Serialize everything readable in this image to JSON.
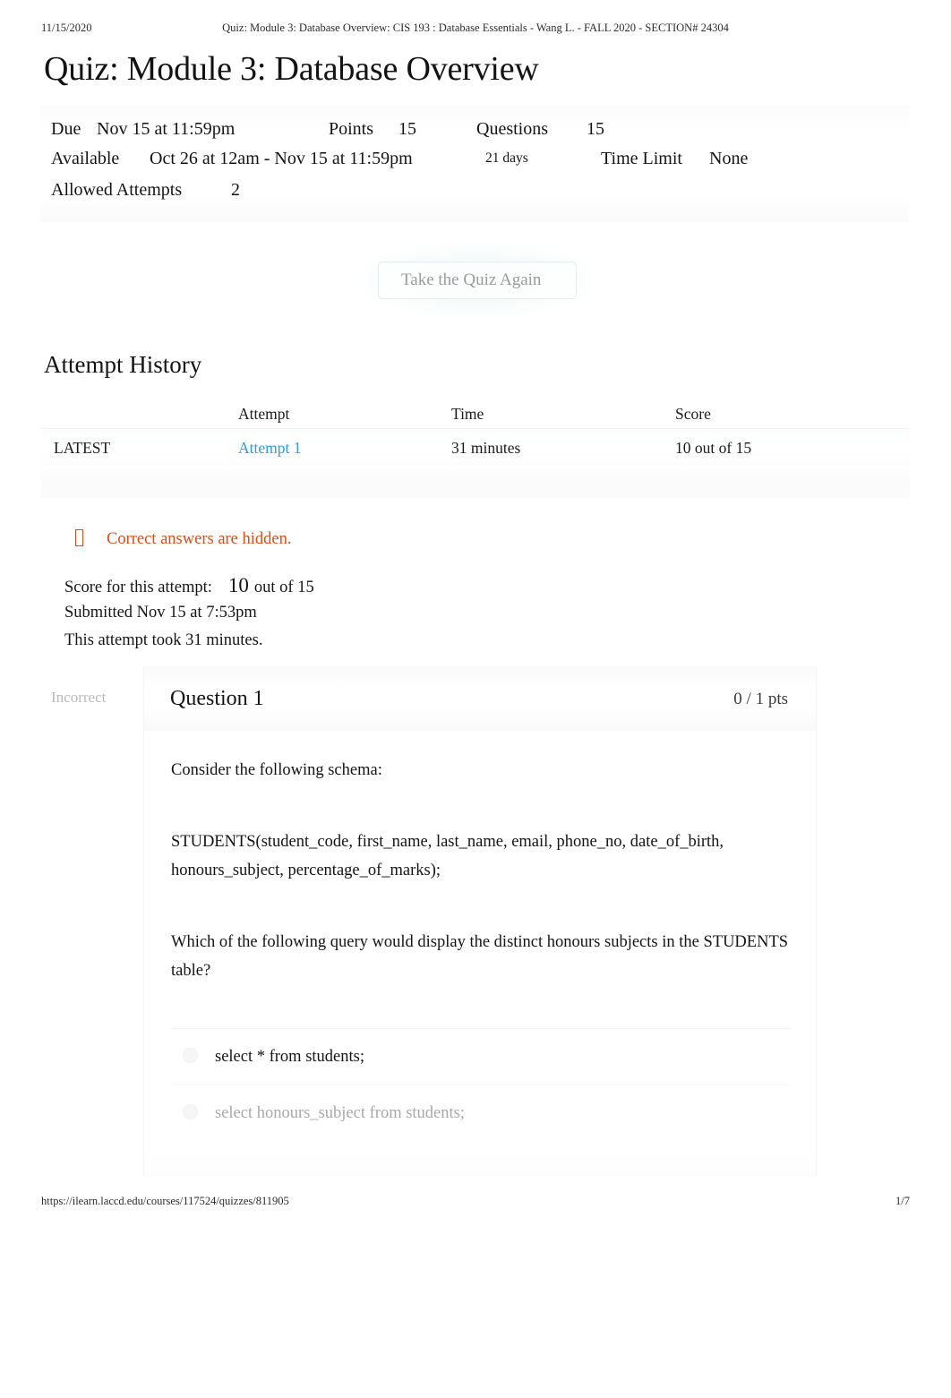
{
  "print_header": {
    "date": "11/15/2020",
    "title": "Quiz: Module 3: Database Overview: CIS 193 : Database Essentials - Wang L. - FALL 2020 - SECTION# 24304"
  },
  "print_footer": {
    "url": "https://ilearn.laccd.edu/courses/117524/quizzes/811905",
    "page": "1/7"
  },
  "page": {
    "title": "Quiz: Module 3: Database Overview"
  },
  "meta": {
    "due_label": "Due",
    "due_value": "Nov 15 at 11:59pm",
    "points_label": "Points",
    "points_value": "15",
    "questions_label": "Questions",
    "questions_value": "15",
    "available_label": "Available",
    "available_value": "Oct 26 at 12am - Nov 15 at 11:59pm",
    "available_duration": "21 days",
    "time_limit_label": "Time Limit",
    "time_limit_value": "None",
    "allowed_attempts_label": "Allowed Attempts",
    "allowed_attempts_value": "2"
  },
  "retake": {
    "label": "Take the Quiz Again"
  },
  "attempt_history": {
    "heading": "Attempt History",
    "columns": [
      "",
      "Attempt",
      "Time",
      "Score"
    ],
    "rows": [
      {
        "kept": "LATEST",
        "attempt": "Attempt 1",
        "time": "31 minutes",
        "score": "10 out of 15"
      }
    ],
    "link_color": "#2b9ce8"
  },
  "notice": {
    "icon": "warning-tofu-icon",
    "text": "Correct answers are hidden.",
    "color": "#dd4c15"
  },
  "attempt_summary": {
    "score_label": "Score for this attempt:",
    "score_value": "10",
    "score_suffix": "out of 15",
    "submitted": "Submitted Nov 15 at 7:53pm",
    "duration": "This attempt took 31 minutes."
  },
  "question": {
    "status": "Incorrect",
    "title": "Question 1",
    "points": "0 / 1 pts",
    "body_paragraphs": [
      "Consider the following schema:",
      "STUDENTS(student_code, first_name, last_name, email, phone_no, date_of_birth, honours_subject, percentage_of_marks);",
      "Which of the following query would display the distinct honours subjects in the STUDENTS table?"
    ],
    "answers": [
      {
        "text": "select * from students;",
        "style": "dark"
      },
      {
        "text": "select honours_subject from students;",
        "style": "faded"
      }
    ]
  }
}
